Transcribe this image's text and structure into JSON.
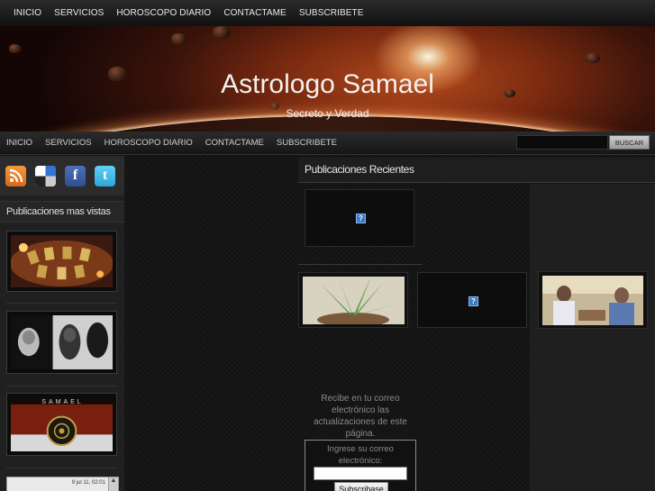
{
  "top_nav": [
    "INICIO",
    "SERVICIOS",
    "HOROSCOPO DIARIO",
    "CONTACTAME",
    "SUBSCRIBETE"
  ],
  "header": {
    "title": "Astrologo Samael",
    "subtitle": "Secreto y Verdad"
  },
  "nav2": [
    "INICIO",
    "SERVICIOS",
    "HOROSCOPO DIARIO",
    "CONTACTAME",
    "SUBSCRIBETE"
  ],
  "search": {
    "button_label": "BUSCAR",
    "placeholder": ""
  },
  "social_icons": [
    "rss-icon",
    "delicious-icon",
    "facebook-icon",
    "twitter-icon"
  ],
  "sidebar": {
    "popular_heading": "Publicaciones mas vistas",
    "thumb3_text": "SAMAEL",
    "widget_date": "9 jul 11, 02:01"
  },
  "main": {
    "heading": "Publicaciones Recientes",
    "placeholder_icon": "?"
  },
  "subscribe": {
    "text": "Recibe en tu correo electrónico las actualizaciones de este página.",
    "label": "Ingrese su correo electrónico:",
    "button": "Subscribase"
  },
  "colors": {
    "accent": "#b24a1c",
    "background": "#151515",
    "sidebar": "#202020"
  }
}
